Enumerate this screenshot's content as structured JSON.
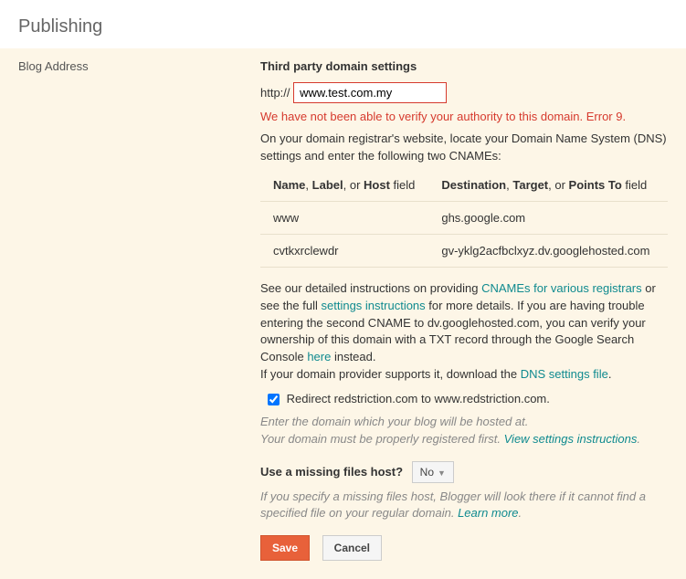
{
  "header": {
    "title": "Publishing"
  },
  "left": {
    "label": "Blog Address"
  },
  "domain": {
    "heading": "Third party domain settings",
    "prefix": "http:// ",
    "value": "www.test.com.my",
    "error": "We have not been able to verify your authority to this domain. Error 9.",
    "instr": "On your domain registrar's website, locate your Domain Name System (DNS) settings and enter the following two CNAMEs:"
  },
  "cname_table": {
    "headers": {
      "name_b1": "Name",
      "name_sep1": ", ",
      "name_b2": "Label",
      "name_sep2": ", or ",
      "name_b3": "Host",
      "name_suffix": " field",
      "dest_b1": "Destination",
      "dest_sep1": ", ",
      "dest_b2": "Target",
      "dest_sep2": ", or ",
      "dest_b3": "Points To",
      "dest_suffix": " field"
    },
    "rows": [
      {
        "name": "www",
        "dest": "ghs.google.com"
      },
      {
        "name": "cvtkxrclewdr",
        "dest": "gv-yklg2acfbclxyz.dv.googlehosted.com"
      }
    ]
  },
  "help": {
    "p1_a": "See our detailed instructions on providing ",
    "p1_link1": "CNAMEs for various registrars",
    "p1_b": " or see the full ",
    "p1_link2": "settings instructions",
    "p1_c": " for more details. If you are having trouble entering the second CNAME to dv.googlehosted.com, you can verify your ownership of this domain with a TXT record through the Google Search Console ",
    "p1_link3": "here",
    "p1_d": " instead.",
    "p2_a": "If your domain provider supports it, download the ",
    "p2_link1": "DNS settings file",
    "p2_b": "."
  },
  "redirect": {
    "checked": true,
    "label": " Redirect redstriction.com to www.redstriction.com."
  },
  "hint1": {
    "line1": "Enter the domain which your blog will be hosted at.",
    "line2_a": "Your domain must be properly registered first. ",
    "line2_link": "View settings instructions",
    "line2_b": "."
  },
  "missing": {
    "label": "Use a missing files host?",
    "value": "No",
    "hint_a": "If you specify a missing files host, Blogger will look there if it cannot find a specified file on your regular domain. ",
    "hint_link": "Learn more",
    "hint_b": "."
  },
  "buttons": {
    "save": "Save",
    "cancel": "Cancel"
  }
}
